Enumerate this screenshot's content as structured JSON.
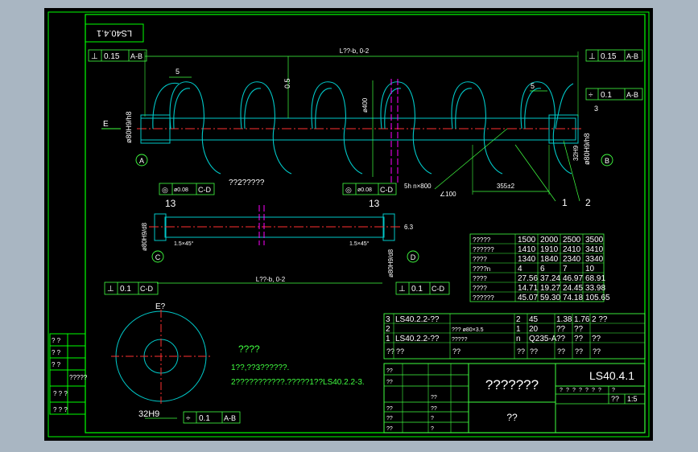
{
  "colors": {
    "background": "#a9b6c2",
    "canvas": "#000000",
    "border": "#00ff00",
    "model": "#00c8c8",
    "center": "#ff3030",
    "section": "#ff00ff",
    "dim": "#40ff40",
    "text": "#ffffff"
  },
  "title_stamp": "LS40.4.1",
  "top_label": "LS40.4.1",
  "main_view": {
    "length_dim": "L??-b, 0-2",
    "flat_dim": "0.5",
    "diameter_dim": "ø400",
    "left_dia": "ø80H9/h8",
    "right_dia": "ø80H9/h8",
    "right_width": "32H9",
    "pitch_dim": "355±2",
    "pitch_note": "5h  n×800",
    "angle_note": "∠100",
    "caption": "??2?????",
    "tol_left": {
      "sym": "⊥",
      "val": "0.15",
      "ref": "A-B"
    },
    "tol_right_top": {
      "sym": "⊥",
      "val": "0.15",
      "ref": "A-B"
    },
    "tol_right_mid": {
      "sym": "÷",
      "val": "0.1",
      "ref": "A-B"
    },
    "weld_left": "5",
    "weld_right": "5",
    "label_e": "E",
    "datum_a": "A",
    "datum_b": "B",
    "leader_1": "1",
    "leader_2": "2",
    "leader_3": "3"
  },
  "shaft_view": {
    "tol_center_left": {
      "sym": "◎",
      "val": "ø0.08",
      "ref": "C-D"
    },
    "tol_center_right": {
      "sym": "◎",
      "val": "ø0.08",
      "ref": "C-D"
    },
    "dim_13_left": "13",
    "dim_13_right": "13",
    "left_dia": "ø80H9/d8",
    "right_dia": "ø80H9/d8",
    "left_chamfer": "1.5×45°",
    "right_chamfer": "1.5×45°",
    "surface": "6.3",
    "length_dim": "L??-b, 0-2",
    "tol_bottom_left": {
      "sym": "⊥",
      "val": "0.1",
      "ref": "C-D"
    },
    "tol_bottom_right": {
      "sym": "⊥",
      "val": "0.1",
      "ref": "C-D"
    },
    "datum_c": "C",
    "datum_d": "D",
    "side_left": "0.1",
    "side_right": "0.1",
    "width": "32H9"
  },
  "section_view": {
    "label": "E?",
    "width_dim": "32H9",
    "tol": {
      "sym": "÷",
      "val": "0.1",
      "ref": "A-B"
    }
  },
  "notes": {
    "heading": "????",
    "line1": "1??,??3??????.",
    "line2": "2???????????.?????1??LS40.2.2-3."
  },
  "param_table": [
    [
      "?????",
      "1500",
      "2000",
      "2500",
      "3500"
    ],
    [
      "??????",
      "1410",
      "1910",
      "2410",
      "3410"
    ],
    [
      "????",
      "1340",
      "1840",
      "2340",
      "3340"
    ],
    [
      "????n",
      "4",
      "6",
      "7",
      "10"
    ],
    [
      "????",
      "27.56",
      "37.24",
      "46.97",
      "68.91"
    ],
    [
      "????",
      "14.71",
      "19.27",
      "24.45",
      "33.98"
    ],
    [
      "??????",
      "45.07",
      "59.30",
      "74.18",
      "105.65"
    ]
  ],
  "parts_list": [
    {
      "no": "3",
      "code": "LS40.2.2-??",
      "name": "",
      "qty": "2",
      "material": "45",
      "unit": "1.38",
      "total": "1.76",
      "note": "2 ??"
    },
    {
      "no": "2",
      "code": "",
      "name": "??? ø80×3.5",
      "qty": "1",
      "material": "20",
      "unit": "??",
      "total": "??",
      "note": ""
    },
    {
      "no": "1",
      "code": "LS40.2.2-??",
      "name": "?????",
      "qty": "n",
      "material": "Q235-A",
      "unit": "??",
      "total": "??",
      "note": "??"
    }
  ],
  "parts_header": [
    "??",
    "??",
    "??",
    "??",
    "??",
    "??",
    "??",
    "??"
  ],
  "title_block": {
    "drawing_name": "???????",
    "drawing_no": "LS40.4.1",
    "scale": "1:5",
    "scale_label": "??",
    "company": "??",
    "row_labels": [
      "??",
      "??",
      "??",
      "??",
      "??"
    ],
    "sign_labels": [
      "??",
      "??",
      "?",
      "?"
    ],
    "stage_labels": [
      "?",
      "?",
      "?",
      "?",
      "?",
      "?",
      "?",
      "?"
    ]
  },
  "left_strip": {
    "labels": [
      "? ?",
      "? ?",
      "? ?",
      "?????",
      "? ? ?",
      "? ? ?"
    ]
  }
}
